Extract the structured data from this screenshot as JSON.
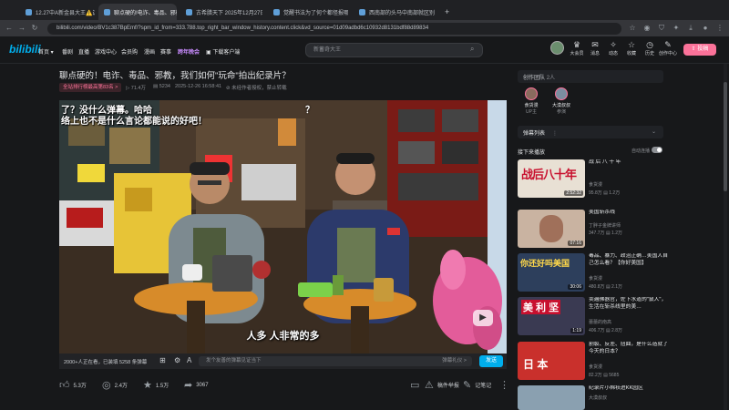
{
  "browser": {
    "tabs": [
      {
        "label": "12.27中A新金县大王⚠️这是说…"
      },
      {
        "label": "聊点硬的!电诈、毒品、邪教…",
        "active": true
      },
      {
        "label": "古希腊天下 2025年12月27日…"
      },
      {
        "label": "觉醒书法为了何个都怪报哪朝代…"
      },
      {
        "label": "西南部的头马中南部就区别【3…"
      },
      {
        "label": "+"
      }
    ],
    "url": "bilibili.com/video/BV1c387BpEmf/?spm_id_from=333.788.top_right_bar_window_history.content.click&vd_source=01d09adbd6c10932d8131bdf88d89834"
  },
  "header": {
    "logo": "bilibili",
    "nav": [
      "首页 ▾",
      "番剧",
      "直播",
      "游戏中心",
      "会员购",
      "漫画",
      "赛事",
      "跨年晚会",
      "下载客户端"
    ],
    "search_placeholder": "新蓄奇大王",
    "icons": [
      {
        "icon": "vip-icon",
        "label": "大会员"
      },
      {
        "icon": "message-icon",
        "label": "消息"
      },
      {
        "icon": "dynamic-icon",
        "label": "动态"
      },
      {
        "icon": "favorite-icon",
        "label": "收藏"
      },
      {
        "icon": "history-icon",
        "label": "历史"
      },
      {
        "icon": "creator-icon",
        "label": "创作中心"
      }
    ],
    "upload_label": "投稿"
  },
  "video": {
    "title": "聊点硬的！电诈、毒品、邪教，我们如何\"玩命\"拍出纪录片？",
    "rank_badge": "全站排行榜最高第83名 >",
    "views": "71.4万",
    "danmaku_count": "5234",
    "datetime": "2025-12-26 16:58:41",
    "notice": "未经作者授权，禁止转载",
    "subtitle_top_line1": "了？没什么弹幕。哈哈",
    "subtitle_top_line2": "络上也不是什么言论都能说的好吧！",
    "subtitle_top_right": "？",
    "subtitle_bottom": "人多 人非常的多",
    "play_icon": "play-icon"
  },
  "danmaku_bar": {
    "watching": "2000+人正在看，已装填 5258 条弹幕",
    "input_placeholder": "发个友善的弹幕见证当下",
    "etiquette": "弹幕礼仪 >",
    "send_label": "发送"
  },
  "actions": [
    {
      "icon": "like-icon",
      "label": "5.3万"
    },
    {
      "icon": "coin-icon",
      "label": "2.4万"
    },
    {
      "icon": "star-icon",
      "label": "1.5万"
    },
    {
      "icon": "share-icon",
      "label": "3067"
    }
  ],
  "actions_right": [
    {
      "icon": "tv-icon",
      "label": ""
    },
    {
      "icon": "report-icon",
      "label": "稿件举报"
    },
    {
      "icon": "note-icon",
      "label": "记笔记"
    },
    {
      "icon": "more-icon",
      "label": "⋮"
    }
  ],
  "sidebar": {
    "crew_title": "创作团队",
    "crew_count": "2人",
    "crew": [
      {
        "name": "食货漫",
        "role": "UP主"
      },
      {
        "name": "大漠叔叔",
        "role": "参演"
      }
    ],
    "danmaku_list_label": "弹幕列表",
    "danmaku_list_more": "⋮",
    "danmaku_list_toggle": "⌄",
    "nextup_label": "接下来播放",
    "autoplay_label": "自动连播",
    "recommendations": [
      {
        "title": "战 后 八 十 年",
        "uploader": "食货漫",
        "views": "95.8万",
        "comments": "1.2万",
        "duration": "2:52:32",
        "thumb_text": "战后八十年"
      },
      {
        "title": "美国斩杀线",
        "uploader": "丁胖子金牌讲师",
        "views": "347.7万",
        "comments": "1.2万",
        "duration": "07:16",
        "thumb_text": ""
      },
      {
        "title": "毒品、暴力、政治正确…美国人自己怎么看？【你好美国】",
        "uploader": "食货漫",
        "views": "480.8万",
        "comments": "2.1万",
        "duration": "30:06",
        "thumb_text": "你还好吗美国"
      },
      {
        "title": "卖遍佛器官，佐下水道的\"鼠人\"，生活在斩杀线里的美…",
        "uploader": "蕾蕾的南高",
        "views": "406.7万",
        "comments": "2.8万",
        "duration": "1:19",
        "thumb_text": "美 利 坚"
      },
      {
        "title": "割裂、反差、扭曲，是什么造就了今天的日本？",
        "uploader": "食货漫",
        "views": "82.2万",
        "comments": "5685",
        "duration": "",
        "thumb_text": "日 本"
      },
      {
        "title": "纪录片小棉袄进KK园区",
        "uploader": "大漠叔叔",
        "views": "",
        "comments": "",
        "duration": "",
        "thumb_text": ""
      }
    ]
  }
}
